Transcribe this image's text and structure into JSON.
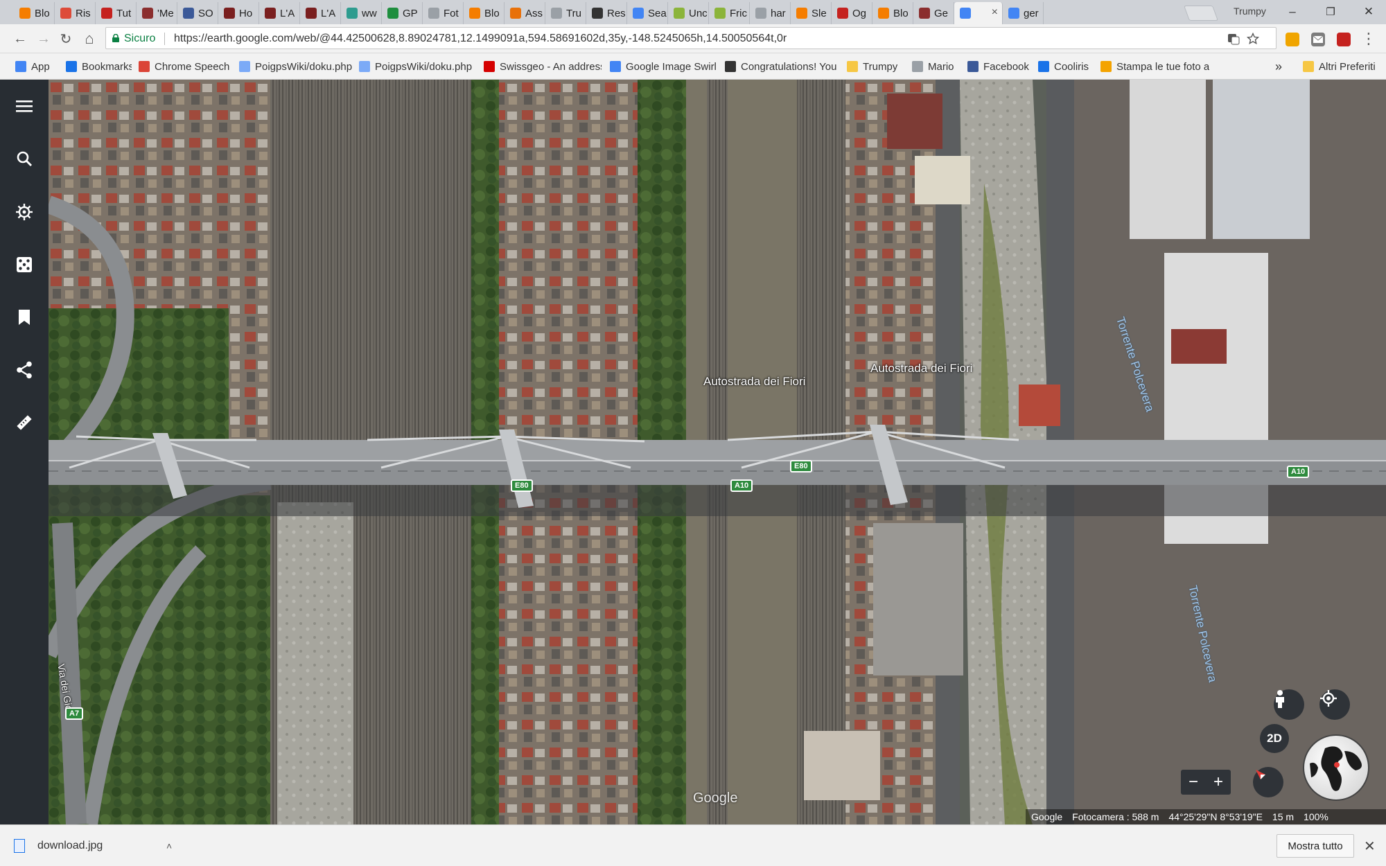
{
  "tabs": [
    {
      "label": "Blo",
      "icon": "blogger-icon",
      "color": "#f57d00"
    },
    {
      "label": "Ris",
      "icon": "google-plus-icon",
      "color": "#dd4b39"
    },
    {
      "label": "Tut",
      "icon": "gmail-icon",
      "color": "#c5221f"
    },
    {
      "label": "'Me",
      "icon": "bird-icon",
      "color": "#8b2e2e"
    },
    {
      "label": "SO",
      "icon": "facebook-icon",
      "color": "#3b5998"
    },
    {
      "label": "Ho",
      "icon": "castle-icon",
      "color": "#7a1f1f"
    },
    {
      "label": "L'A",
      "icon": "castle-icon",
      "color": "#7a1f1f"
    },
    {
      "label": "L'A",
      "icon": "castle-icon",
      "color": "#7a1f1f"
    },
    {
      "label": "ww",
      "icon": "asterisk-icon",
      "color": "#2e9c8f"
    },
    {
      "label": "GP",
      "icon": "g-icon",
      "color": "#1e8e3e"
    },
    {
      "label": "Fot",
      "icon": "page-icon",
      "color": "#9aa0a6"
    },
    {
      "label": "Blo",
      "icon": "blogger-icon",
      "color": "#f57d00"
    },
    {
      "label": "Ass",
      "icon": "colorful-icon",
      "color": "#e8710a"
    },
    {
      "label": "Tru",
      "icon": "page-icon",
      "color": "#9aa0a6"
    },
    {
      "label": "Res",
      "icon": "ir-icon",
      "color": "#333333"
    },
    {
      "label": "Sea",
      "icon": "google-icon",
      "color": "#4285f4"
    },
    {
      "label": "Unc",
      "icon": "circle-icon",
      "color": "#8bb43a"
    },
    {
      "label": "Fric",
      "icon": "circle-icon",
      "color": "#8bb43a"
    },
    {
      "label": "har",
      "icon": "page-icon",
      "color": "#9aa0a6"
    },
    {
      "label": "Sle",
      "icon": "blogger-icon",
      "color": "#f57d00"
    },
    {
      "label": "Og",
      "icon": "fc-icon",
      "color": "#c5221f"
    },
    {
      "label": "Blo",
      "icon": "blogger-icon",
      "color": "#f57d00"
    },
    {
      "label": "Ge",
      "icon": "bird-icon",
      "color": "#8b2e2e"
    },
    {
      "label": "",
      "icon": "earth-icon",
      "color": "#4285f4",
      "active": true
    },
    {
      "label": "ger",
      "icon": "google-icon",
      "color": "#4285f4"
    }
  ],
  "window": {
    "profile": "Trumpy",
    "minimize": "–",
    "maximize": "❐",
    "close": "✕",
    "tab_close": "×"
  },
  "toolbar": {
    "back": "←",
    "forward": "→",
    "reload": "↻",
    "home": "⌂",
    "secure_label": "Sicuro",
    "url": "https://earth.google.com/web/@44.42500628,8.89024781,12.1499091a,594.58691602d,35y,-148.5245065h,14.50050564t,0r",
    "menu": "⋮"
  },
  "bookmarks": [
    {
      "label": "App",
      "icon": "apps-icon",
      "color": "#4285f4"
    },
    {
      "label": "Bookmarks",
      "icon": "star-icon",
      "color": "#1a73e8"
    },
    {
      "label": "Chrome Speech",
      "icon": "chrome-icon",
      "color": "#db4437"
    },
    {
      "label": "PoigpsWiki/doku.php",
      "icon": "wiki-icon",
      "color": "#7baaf7"
    },
    {
      "label": "PoigpsWiki/doku.php",
      "icon": "wiki-icon",
      "color": "#7baaf7"
    },
    {
      "label": "Swissgeo - An address",
      "icon": "red-dot-icon",
      "color": "#d50000"
    },
    {
      "label": "Google Image Swirl",
      "icon": "google-icon",
      "color": "#4285f4"
    },
    {
      "label": "Congratulations! You",
      "icon": "x-icon",
      "color": "#333333"
    },
    {
      "label": "Trumpy",
      "icon": "folder-icon",
      "color": "#f6c744"
    },
    {
      "label": "Mario",
      "icon": "page-icon",
      "color": "#9aa0a6"
    },
    {
      "label": "Facebook",
      "icon": "facebook-icon",
      "color": "#3b5998"
    },
    {
      "label": "Cooliris",
      "icon": "cooliris-icon",
      "color": "#1a73e8"
    },
    {
      "label": "Stampa le tue foto a",
      "icon": "photo-icon",
      "color": "#f4a300"
    }
  ],
  "bookmarks_more": "»",
  "bookmarks_other": "Altri Preferiti",
  "map": {
    "road_label_1": "Autostrada dei Fiori",
    "road_label_2": "Autostrada dei Fiori",
    "river_label_1": "Torrente Polcevera",
    "river_label_2": "Torrente Polcevera",
    "street_label": "Via dei Giovi",
    "shields": [
      "E80",
      "E80",
      "A10",
      "A10",
      "A7"
    ],
    "watermark": "Google",
    "controls": {
      "two_d": "2D",
      "zoom_out": "−",
      "zoom_in": "+"
    },
    "status": {
      "attribution": "Google",
      "camera": "Fotocamera : 588 m",
      "coords": "44°25'29\"N 8°53'19\"E",
      "elevation": "15 m",
      "loading": "100%"
    }
  },
  "download": {
    "filename": "download.jpg",
    "show_all": "Mostra tutto",
    "close": "✕",
    "chevron": "˄"
  },
  "colors": {
    "accent_green": "#0b8043",
    "sidebar_bg": "#282d33",
    "shield_green": "#2e8b3e"
  }
}
